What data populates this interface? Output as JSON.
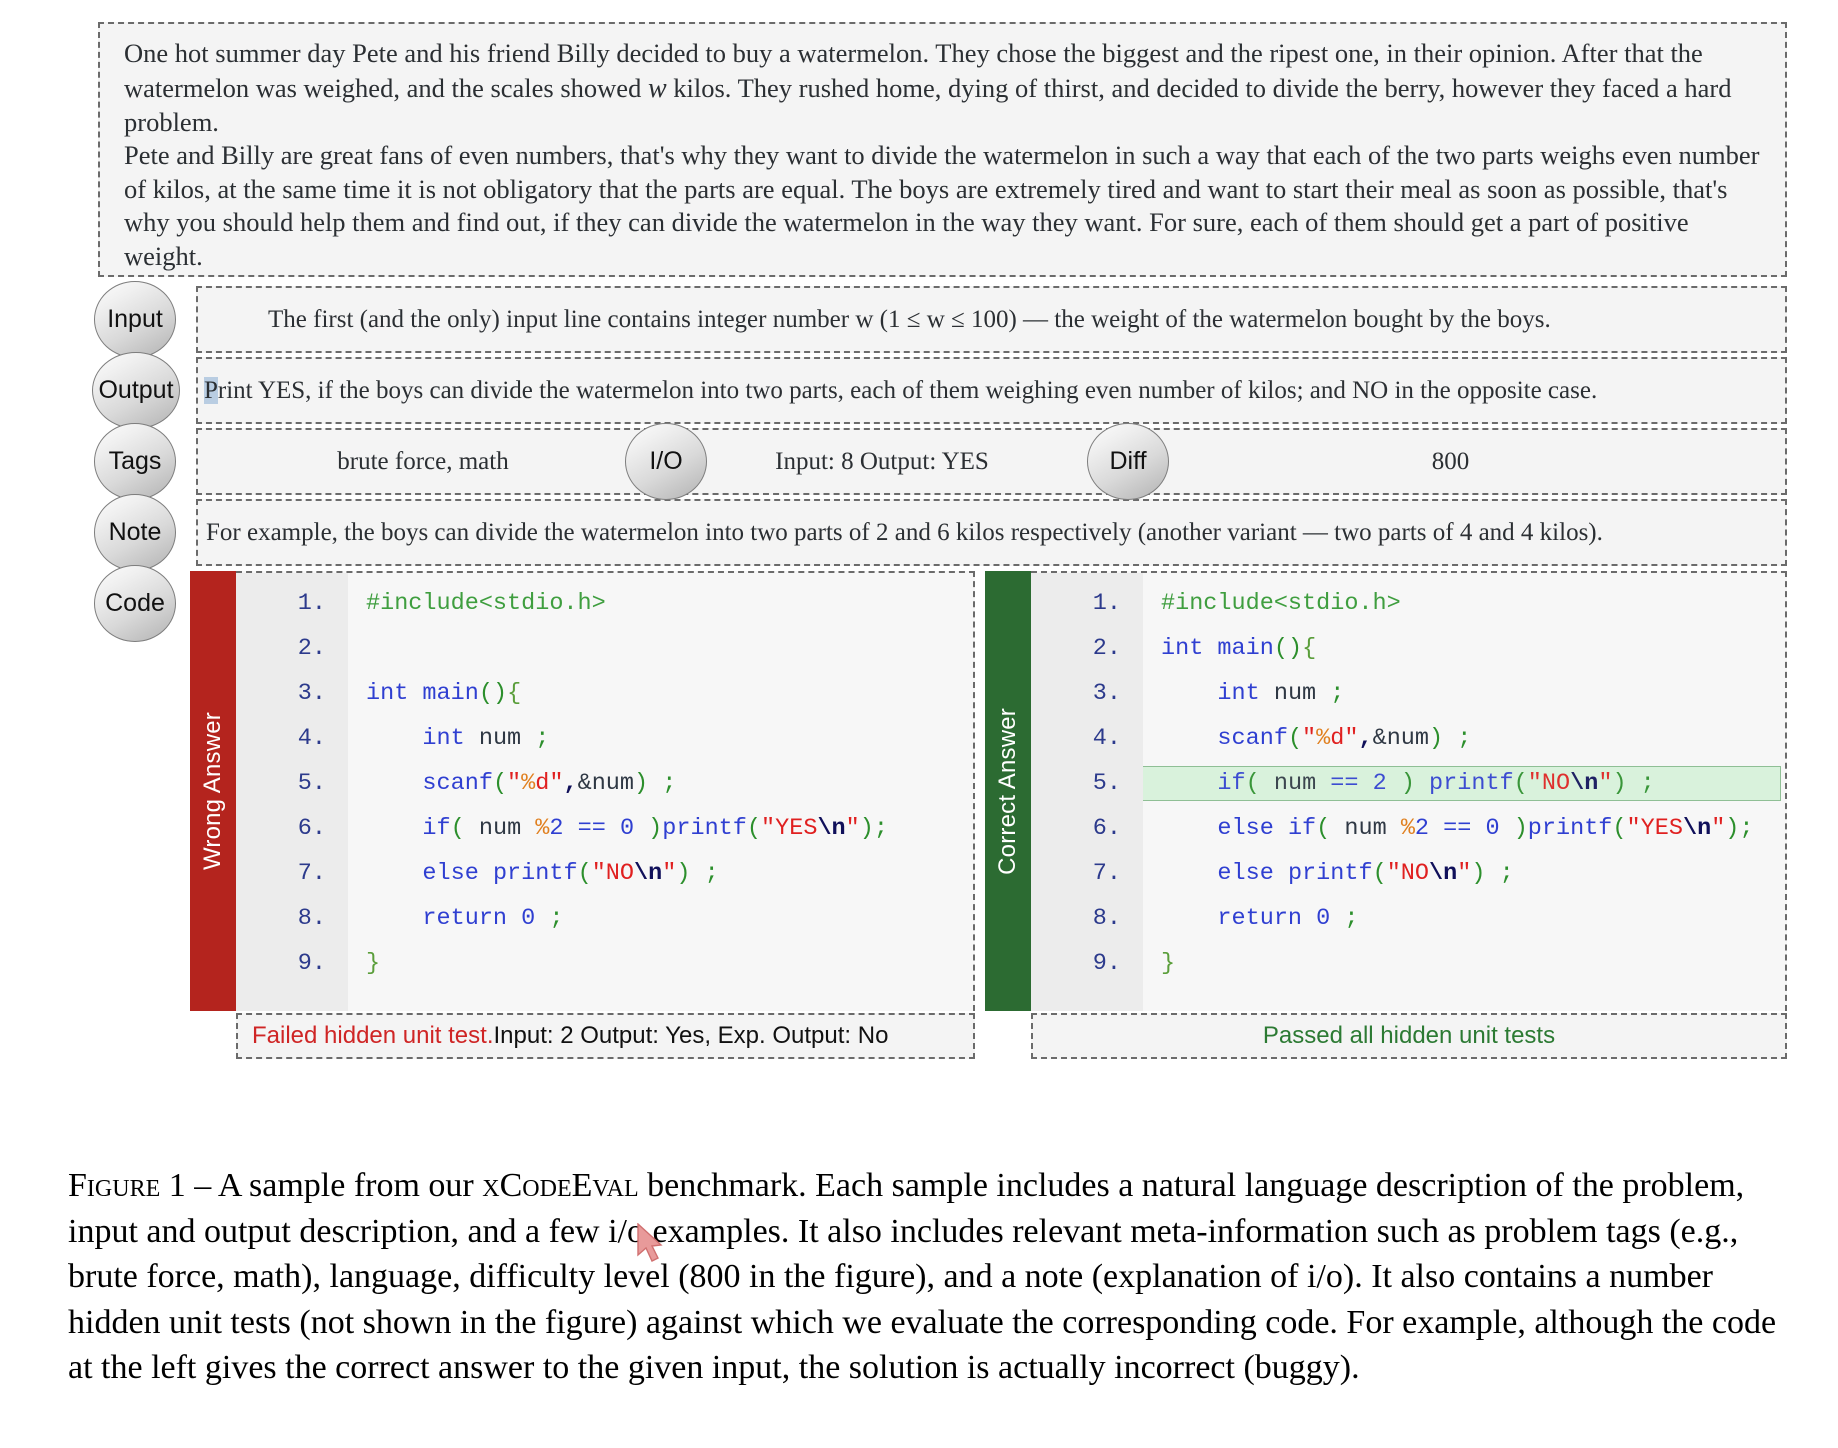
{
  "description": {
    "paragraph1_a": "One hot summer day Pete and his friend Billy decided to buy a watermelon. They chose the biggest and the ripest one, in their opinion. After that the watermelon was weighed, and the scales showed ",
    "paragraph1_var": "w",
    "paragraph1_b": " kilos. They rushed home, dying of thirst, and decided to divide the berry, however they faced a hard problem.",
    "paragraph2": "Pete and Billy are great fans of even numbers, that's why they want to divide the watermelon in such a way that each of the two parts weighs even number of kilos, at the same time it is not obligatory that the parts are equal. The boys are extremely tired and want to start their meal as soon as possible, that's why you should help them and find out, if they can divide the watermelon in the way they want. For sure, each of them should get a part of positive weight."
  },
  "rows": {
    "input": {
      "label": "Input",
      "text": "The first (and the only) input line contains integer number w (1 ≤ w ≤ 100) — the weight of the watermelon bought by the boys."
    },
    "output": {
      "label": "Output",
      "selected_char": "P",
      "text": "rint YES, if the boys can divide the watermelon into two parts, each of them weighing even number of kilos; and NO in the opposite case."
    },
    "tags": {
      "label": "Tags",
      "value": "brute force, math"
    },
    "io": {
      "label": "I/O",
      "value": "Input: 8 Output: YES"
    },
    "diff": {
      "label": "Diff",
      "value": "800"
    },
    "note": {
      "label": "Note",
      "text": "For example, the boys can divide the watermelon into two parts of 2 and 6 kilos respectively (another variant — two parts of 4 and 4 kilos)."
    },
    "code": {
      "label": "Code"
    }
  },
  "code_panels": {
    "left": {
      "verdict_label": "Wrong Answer",
      "verdict_color": "#b4241e",
      "status_highlight": "Failed hidden unit test.",
      "status_rest": " Input: 2 Output: Yes, Exp. Output: No",
      "lines": [
        {
          "n": "1.",
          "text": "#include<stdio.h>"
        },
        {
          "n": "2.",
          "text": ""
        },
        {
          "n": "3.",
          "text": "int main(){"
        },
        {
          "n": "4.",
          "text": "    int num ;"
        },
        {
          "n": "5.",
          "text": "    scanf(\"%d\",&num) ;"
        },
        {
          "n": "6.",
          "text": "    if( num %2 == 0 )printf(\"YES\\n\");"
        },
        {
          "n": "7.",
          "text": "    else printf(\"NO\\n\") ;"
        },
        {
          "n": "8.",
          "text": "    return 0 ;"
        },
        {
          "n": "9.",
          "text": "}"
        }
      ]
    },
    "right": {
      "verdict_label": "Correct Answer",
      "verdict_color": "#2c6b32",
      "status_text": "Passed all hidden unit tests",
      "highlighted_line": 5,
      "lines": [
        {
          "n": "1.",
          "text": "#include<stdio.h>"
        },
        {
          "n": "2.",
          "text": "int main(){"
        },
        {
          "n": "3.",
          "text": "    int num ;"
        },
        {
          "n": "4.",
          "text": "    scanf(\"%d\",&num) ;"
        },
        {
          "n": "5.",
          "text": "    if( num == 2 ) printf(\"NO\\n\") ;"
        },
        {
          "n": "6.",
          "text": "    else if( num %2 == 0 )printf(\"YES\\n\");"
        },
        {
          "n": "7.",
          "text": "    else printf(\"NO\\n\") ;"
        },
        {
          "n": "8.",
          "text": "    return 0 ;"
        },
        {
          "n": "9.",
          "text": "}"
        }
      ]
    }
  },
  "caption": {
    "label": "Figure 1",
    "dash": " – ",
    "part_a": "A sample from our ",
    "benchmark": "xCodeEval",
    "part_b": " benchmark. Each sample includes a natural language description of the problem, input and output description, and a few i/o examples. It also includes relevant meta-information such as problem tags (e.g., brute force, math), language, difficulty level (800 in the figure), and a note (explanation of i/o). It also contains a number hidden unit tests (not shown in the figure) against which we evaluate the corresponding code. For example, although the code at the left gives the correct answer to the given input, the solution is actually incorrect (buggy)."
  },
  "colors": {
    "wrong": "#b4241e",
    "correct": "#2c6b32",
    "highlight_row": "#d9f2dc",
    "panel_bg": "#f4f4f4"
  }
}
